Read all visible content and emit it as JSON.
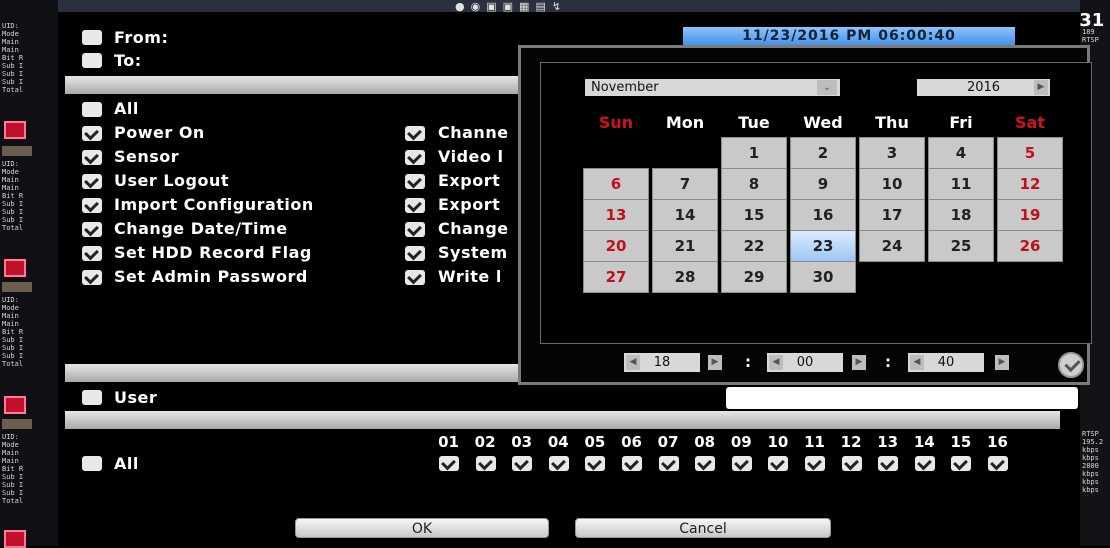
{
  "top_bar": {
    "clock_tail": ":31"
  },
  "left_strip": {
    "block1": "UID:\nMode\nMain\nMain\nBit R\nSub I\nSub I\nSub I\nTotal",
    "block2": "UID:\nMode\nMain\nMain\nBit R\nSub I\nSub I\nSub I\nTotal",
    "block3": "UID:\nMode\nMain\nMain\nBit R\nSub I\nSub I\nSub I\nTotal",
    "block4": "UID:\nMode\nMain\nMain\nBit R\nSub I\nSub I\nSub I\nTotal"
  },
  "right_strip": {
    "block1": "189\nRTSP",
    "block2": "RTSP\n195.2\nkbps\nkbps\n2800\nkbps\nkbps\nkbps"
  },
  "filter": {
    "from_label": "From:",
    "to_label": "To:",
    "date_display": "11/23/2016 PM 06:00:40"
  },
  "events": {
    "all_label": "All",
    "left_column": [
      {
        "label": "Power On"
      },
      {
        "label": "Sensor"
      },
      {
        "label": "User Logout"
      },
      {
        "label": "Import Configuration"
      },
      {
        "label": "Change Date/Time"
      },
      {
        "label": "Set HDD Record Flag"
      },
      {
        "label": "Set Admin Password"
      }
    ],
    "right_column": [
      {
        "label": "Channe"
      },
      {
        "label": "Video l"
      },
      {
        "label": "Export"
      },
      {
        "label": "Export"
      },
      {
        "label": "Change"
      },
      {
        "label": "System"
      },
      {
        "label": "Write l"
      }
    ]
  },
  "calendar": {
    "month": "November",
    "year": "2016",
    "weekdays": [
      "Sun",
      "Mon",
      "Tue",
      "Wed",
      "Thu",
      "Fri",
      "Sat"
    ],
    "days": [
      "1",
      "2",
      "3",
      "4",
      "5",
      "6",
      "7",
      "8",
      "9",
      "10",
      "11",
      "12",
      "13",
      "14",
      "15",
      "16",
      "17",
      "18",
      "19",
      "20",
      "21",
      "22",
      "23",
      "24",
      "25",
      "26",
      "27",
      "28",
      "29",
      "30"
    ],
    "selected_day": "23",
    "weekend_color": "#c0101c",
    "time": {
      "hour": "18",
      "minute": "00",
      "second": "40"
    }
  },
  "user": {
    "label": "User",
    "value": ""
  },
  "channels": {
    "all_label": "All",
    "numbers": [
      "01",
      "02",
      "03",
      "04",
      "05",
      "06",
      "07",
      "08",
      "09",
      "10",
      "11",
      "12",
      "13",
      "14",
      "15",
      "16"
    ]
  },
  "buttons": {
    "ok": "OK",
    "cancel": "Cancel"
  }
}
